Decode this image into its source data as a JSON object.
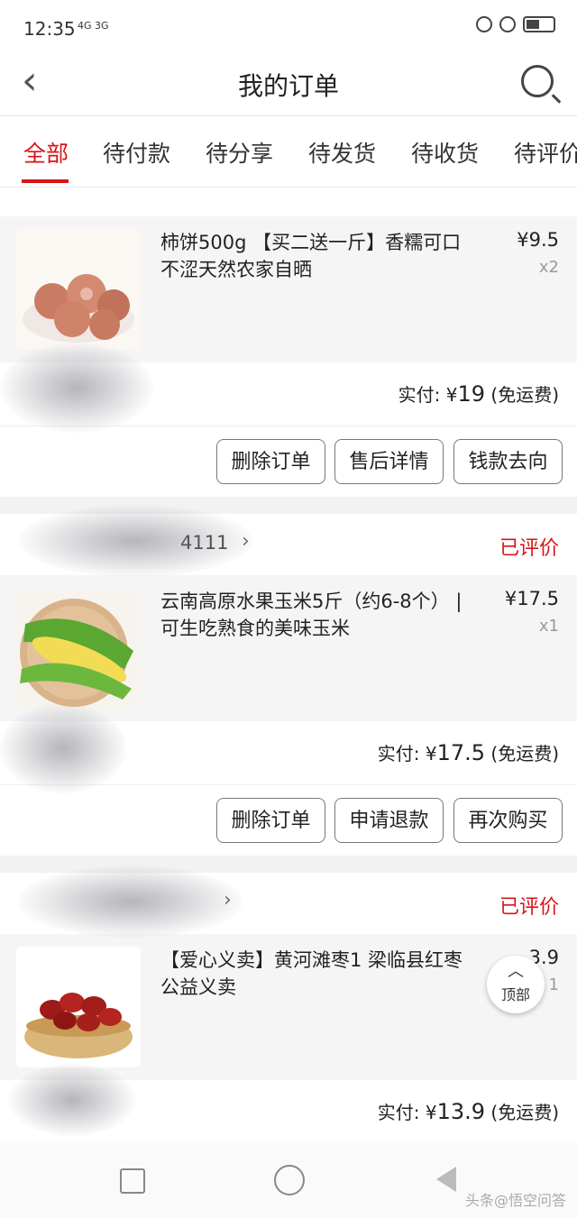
{
  "status_bar": {
    "time": "12:35",
    "signal": "4G 3G"
  },
  "header": {
    "title": "我的订单"
  },
  "tabs": [
    {
      "label": "全部",
      "active": true
    },
    {
      "label": "待付款"
    },
    {
      "label": "待分享"
    },
    {
      "label": "待发货"
    },
    {
      "label": "待收货"
    },
    {
      "label": "待评价"
    }
  ],
  "orders": [
    {
      "store": "",
      "status": "",
      "item": {
        "name": "柿饼500g 【买二送一斤】香糯可口不涩天然农家自晒",
        "price": "¥9.5",
        "qty": "x2"
      },
      "total_label": "实付:",
      "total_currency": "¥",
      "total_value": "19",
      "shipping": "(免运费)",
      "buttons": [
        "删除订单",
        "售后详情",
        "钱款去向"
      ]
    },
    {
      "store": "4111",
      "status": "已评价",
      "item": {
        "name": "云南高原水果玉米5斤（约6-8个） | 可生吃熟食的美味玉米",
        "price": "¥17.5",
        "qty": "x1"
      },
      "total_label": "实付:",
      "total_currency": "¥",
      "total_value": "17.5",
      "shipping": "(免运费)",
      "buttons": [
        "删除订单",
        "申请退款",
        "再次购买"
      ]
    },
    {
      "store": "",
      "status": "已评价",
      "item": {
        "name": "【爱心义卖】黄河滩枣1 梁临县红枣公益义卖",
        "price": "3.9",
        "qty": "1"
      },
      "total_label": "实付:",
      "total_currency": "¥",
      "total_value": "13.9",
      "shipping": "(免运费)"
    }
  ],
  "top_button": {
    "label": "顶部"
  },
  "watermark": "头条@悟空问答"
}
